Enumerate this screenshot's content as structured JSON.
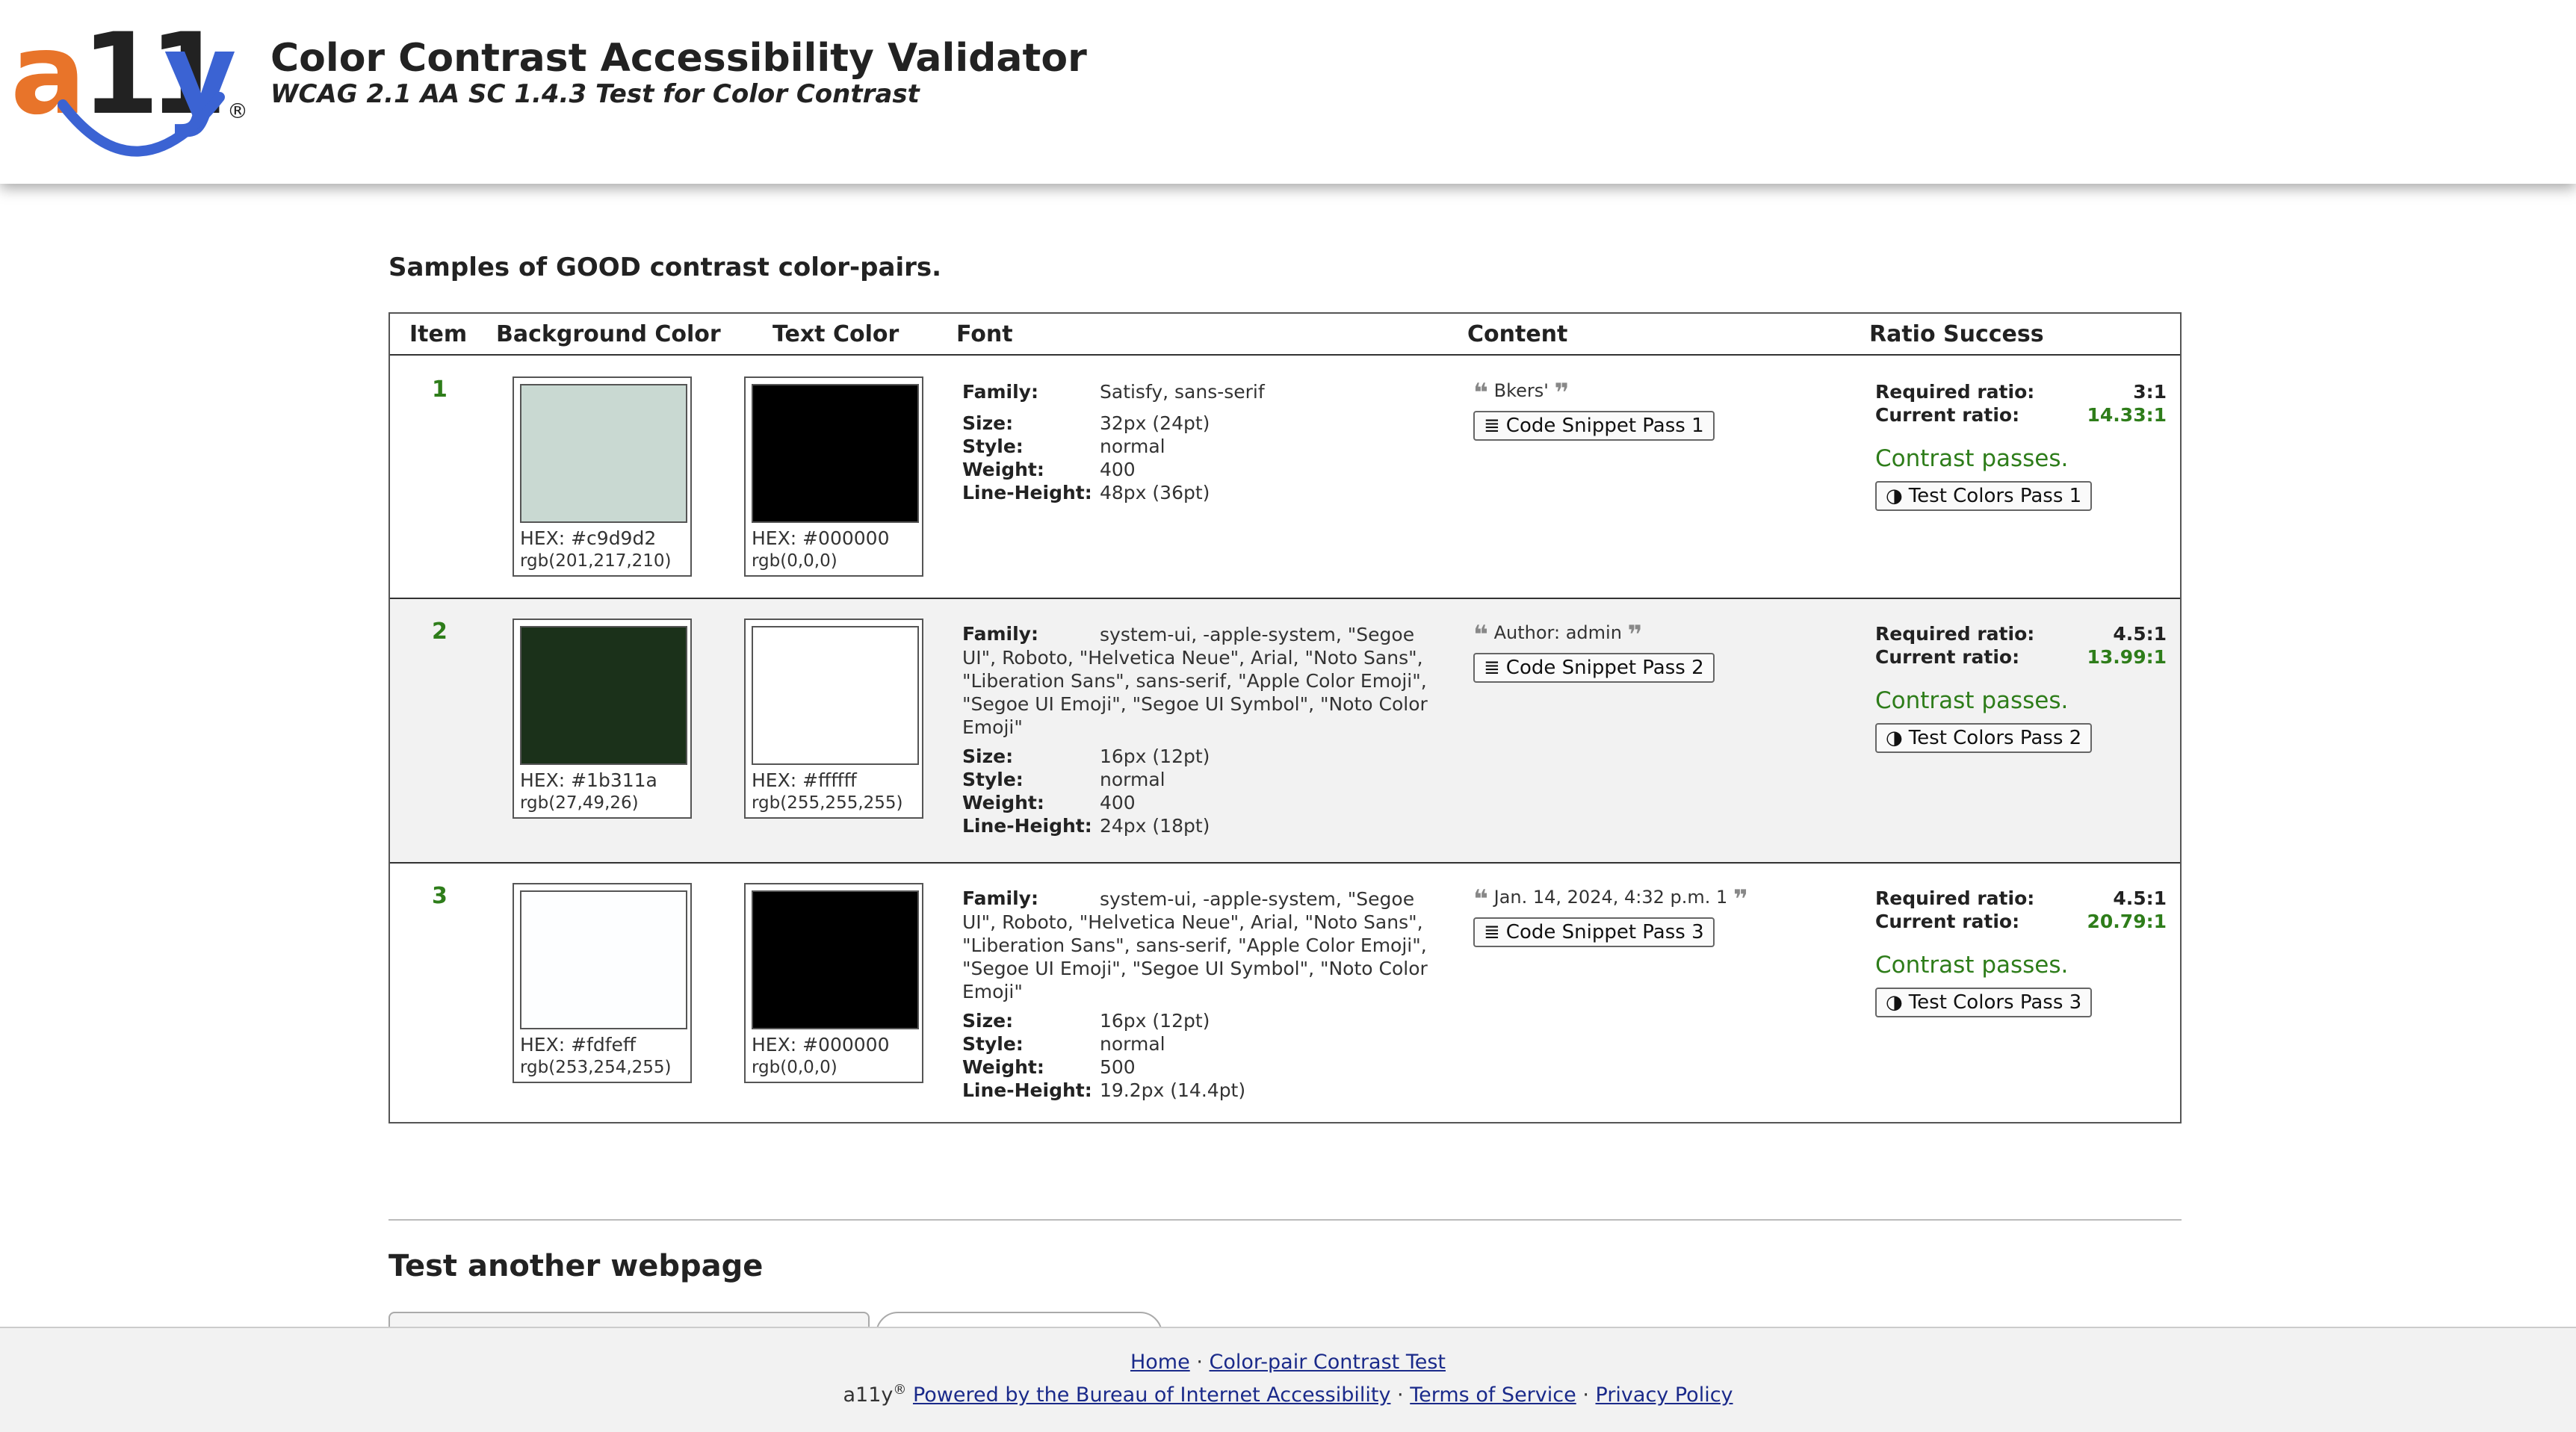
{
  "header": {
    "logo": {
      "text_a": "a",
      "text_11": "11",
      "text_y": "y",
      "reg": "®"
    },
    "title": "Color Contrast Accessibility Validator",
    "subtitle": "WCAG 2.1 AA SC 1.4.3 Test for Color Contrast"
  },
  "section_title": "Samples of GOOD contrast color-pairs.",
  "table": {
    "headers": [
      "Item",
      "Background Color",
      "Text Color",
      "Font",
      "Content",
      "Ratio Success"
    ],
    "font_labels": {
      "family": "Family:",
      "size": "Size:",
      "style": "Style:",
      "weight": "Weight:",
      "line_height": "Line-Height:"
    },
    "ratio_labels": {
      "required": "Required ratio:",
      "current": "Current ratio:"
    },
    "rows": [
      {
        "item": "1",
        "bg": {
          "hex": "HEX: #c9d9d2",
          "rgb": "rgb(201,217,210)",
          "color": "#c9d9d2"
        },
        "text": {
          "hex": "HEX: #000000",
          "rgb": "rgb(0,0,0)",
          "color": "#000000"
        },
        "font": {
          "family": "Satisfy, sans-serif",
          "size": "32px (24pt)",
          "style": "normal",
          "weight": "400",
          "line_height": "48px (36pt)"
        },
        "content": "Bkers'",
        "snippet_button": "Code Snippet Pass 1",
        "required": "3:1",
        "current": "14.33:1",
        "passes": "Contrast passes.",
        "test_button": "Test Colors Pass 1"
      },
      {
        "item": "2",
        "bg": {
          "hex": "HEX: #1b311a",
          "rgb": "rgb(27,49,26)",
          "color": "#1b311a"
        },
        "text": {
          "hex": "HEX: #ffffff",
          "rgb": "rgb(255,255,255)",
          "color": "#ffffff"
        },
        "font": {
          "family": "system-ui, -apple-system, \"Segoe UI\", Roboto, \"Helvetica Neue\", Arial, \"Noto Sans\", \"Liberation Sans\", sans-serif, \"Apple Color Emoji\", \"Segoe UI Emoji\", \"Segoe UI Symbol\", \"Noto Color Emoji\"",
          "size": "16px (12pt)",
          "style": "normal",
          "weight": "400",
          "line_height": "24px (18pt)"
        },
        "content": "Author: admin",
        "snippet_button": "Code Snippet Pass 2",
        "required": "4.5:1",
        "current": "13.99:1",
        "passes": "Contrast passes.",
        "test_button": "Test Colors Pass 2"
      },
      {
        "item": "3",
        "bg": {
          "hex": "HEX: #fdfeff",
          "rgb": "rgb(253,254,255)",
          "color": "#fdfeff"
        },
        "text": {
          "hex": "HEX: #000000",
          "rgb": "rgb(0,0,0)",
          "color": "#000000"
        },
        "font": {
          "family": "system-ui, -apple-system, \"Segoe UI\", Roboto, \"Helvetica Neue\", Arial, \"Noto Sans\", \"Liberation Sans\", sans-serif, \"Apple Color Emoji\", \"Segoe UI Emoji\", \"Segoe UI Symbol\", \"Noto Color Emoji\"",
          "size": "16px (12pt)",
          "style": "normal",
          "weight": "500",
          "line_height": "19.2px (14.4pt)"
        },
        "content": "Jan. 14, 2024, 4:32 p.m. 1",
        "snippet_button": "Code Snippet Pass 3",
        "required": "4.5:1",
        "current": "20.79:1",
        "passes": "Contrast passes.",
        "test_button": "Test Colors Pass 3"
      }
    ]
  },
  "test_another_title": "Test another webpage",
  "footer": {
    "home": "Home",
    "sep": "·",
    "color_pair_test": "Color-pair Contrast Test",
    "brand": "a11y",
    "reg": "®",
    "powered_by": "Powered by the Bureau of Internet Accessibility",
    "terms": "Terms of Service",
    "privacy": "Privacy Policy"
  },
  "icons": {
    "quote_open": "❝",
    "quote_close": "❞",
    "snippet_icon": "≣",
    "contrast_icon": "◑"
  },
  "colors": {
    "accent_green": "#2e7d1a",
    "logo_orange": "#e8742a",
    "logo_blue": "#3b63d3",
    "link_blue": "#1a2a8a"
  }
}
